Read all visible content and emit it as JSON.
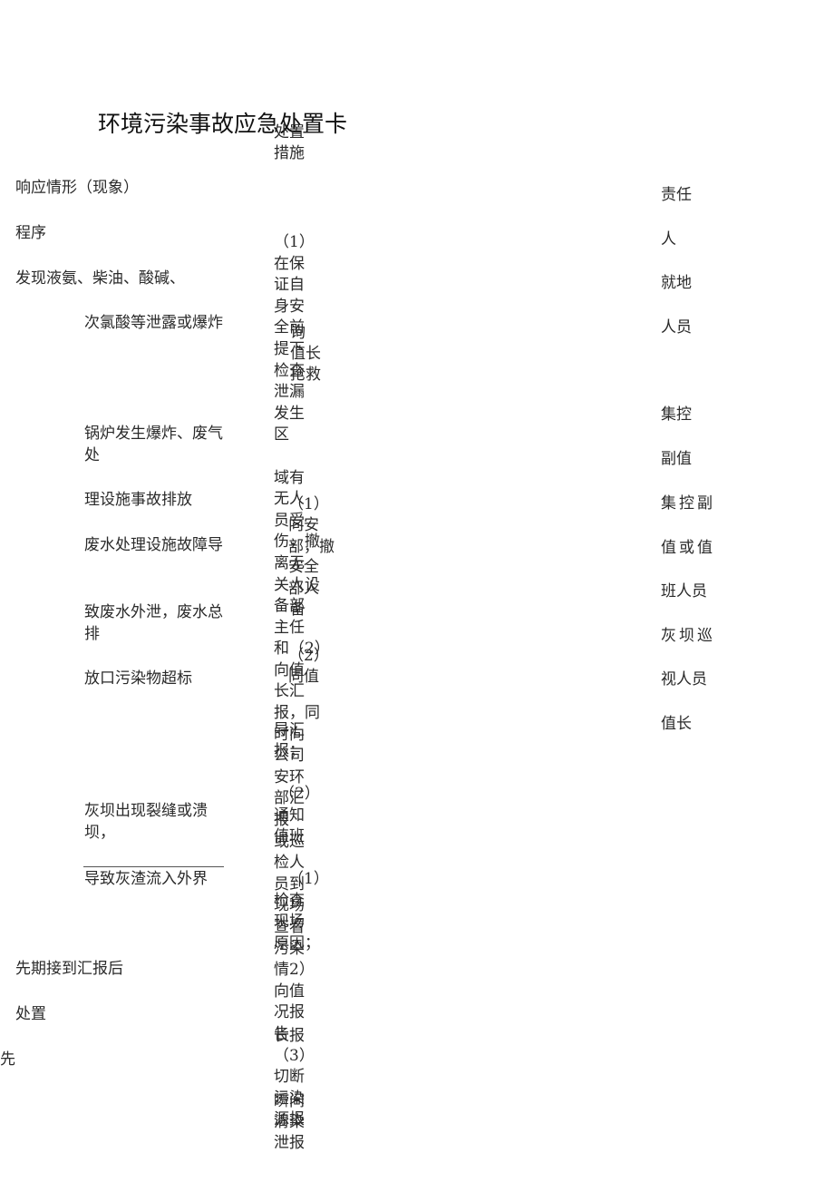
{
  "document": {
    "title": "环境污染事故应急处置卡",
    "header_measures": [
      "处置",
      "措施"
    ],
    "header_situation": "响应情形（现象）",
    "header_procedure": "程序",
    "header_responsible": [
      "责任",
      "人"
    ]
  },
  "situations": {
    "intro": "发现液氨、柴油、酸碱、",
    "items": [
      "次氯酸等泄露或爆炸",
      "锅炉发生爆炸、废气处",
      "理设施事故排放",
      "废水处理设施故障导",
      "致废水外泄，废水总排",
      "放口污染物超标",
      "灰坝出现裂缝或溃坝，",
      "导致灰渣流入外界"
    ]
  },
  "procedure": {
    "step_label_1": "先期接到汇报后",
    "step_label_2": "处置",
    "step_label_3": "先"
  },
  "measures_column": {
    "lines": [
      "（1）",
      "在保",
      "证自",
      "身安",
      "全前",
      "提下",
      "检查",
      "泄漏",
      "发生",
      "区",
      "",
      "域有",
      "无人",
      "员受",
      "伤，撤",
      "离无",
      "关人设",
      "备部",
      "主任",
      "和（2）",
      "向值",
      "长汇",
      "报，同",
      "时向",
      "公司",
      "安环",
      "部汇",
      "报",
      "或巡",
      "检人",
      "员到",
      "现场",
      "查看",
      "污染",
      "情2）",
      "向值",
      "况报",
      "告",
      "（3）",
      "切断",
      "污染",
      "源报"
    ],
    "overlay_lines": [
      "询",
      "值长",
      "抢救",
      "（1）",
      "向安",
      "部，撤",
      "安全",
      "部人",
      "备",
      "（2）",
      "同值",
      "导汇",
      "报；",
      "（2）",
      "通知",
      "值班",
      "（1）",
      "检查",
      "现场",
      "原因；",
      "长报",
      "瞬间",
      "清染",
      "泄报"
    ]
  },
  "responsible": {
    "items": [
      "就地",
      "人员",
      "集控",
      "副值",
      "集控副",
      "值或值",
      "班人员",
      "灰坝巡",
      "视人员",
      "值长"
    ]
  }
}
